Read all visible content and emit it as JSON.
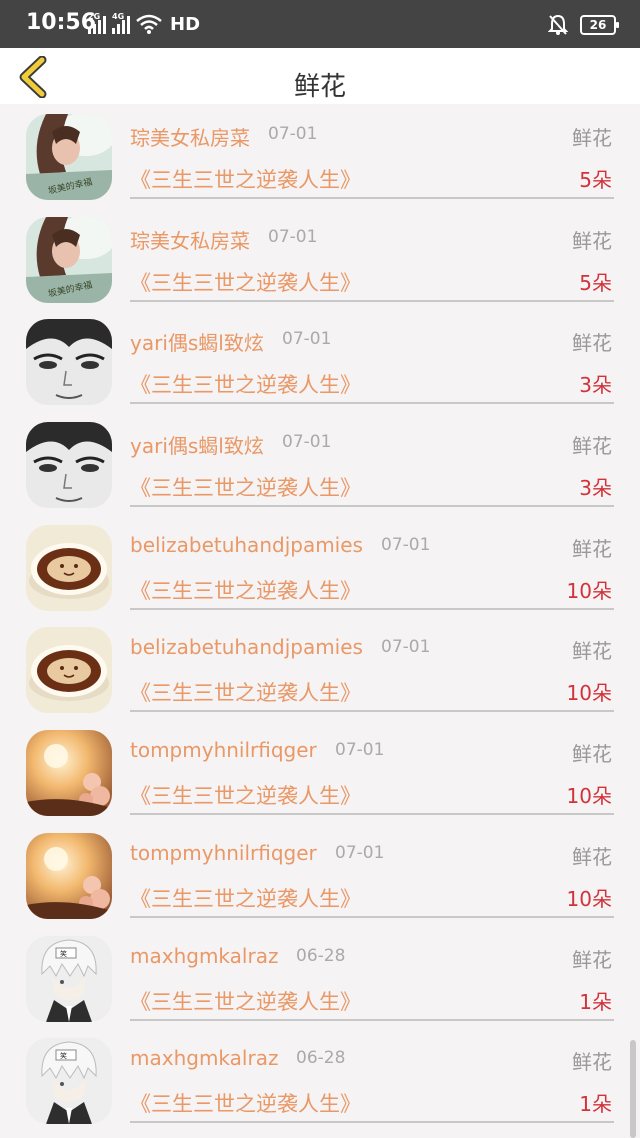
{
  "status_bar": {
    "time": "10:56",
    "sig1_label": "2G",
    "sig2_label": "4G",
    "hd_label": "HD",
    "battery": "26"
  },
  "header": {
    "title": "鲜花"
  },
  "items": [
    {
      "name": "琮美女私房菜",
      "date": "07-01",
      "type": "鲜花",
      "book": "《三生三世之逆袭人生》",
      "amount": "5朵",
      "avatar": "girl-portrait"
    },
    {
      "name": "琮美女私房菜",
      "date": "07-01",
      "type": "鲜花",
      "book": "《三生三世之逆袭人生》",
      "amount": "5朵",
      "avatar": "girl-portrait"
    },
    {
      "name": "yari偶s蝎l致炫",
      "date": "07-01",
      "type": "鲜花",
      "book": "《三生三世之逆袭人生》",
      "amount": "3朵",
      "avatar": "sketch-face"
    },
    {
      "name": "yari偶s蝎l致炫",
      "date": "07-01",
      "type": "鲜花",
      "book": "《三生三世之逆袭人生》",
      "amount": "3朵",
      "avatar": "sketch-face"
    },
    {
      "name": "belizabetuhandjpamies",
      "date": "07-01",
      "type": "鲜花",
      "book": "《三生三世之逆袭人生》",
      "amount": "10朵",
      "avatar": "coffee-cup"
    },
    {
      "name": "belizabetuhandjpamies",
      "date": "07-01",
      "type": "鲜花",
      "book": "《三生三世之逆袭人生》",
      "amount": "10朵",
      "avatar": "coffee-cup"
    },
    {
      "name": "tompmyhnilrfiqger",
      "date": "07-01",
      "type": "鲜花",
      "book": "《三生三世之逆袭人生》",
      "amount": "10朵",
      "avatar": "sunset-rose"
    },
    {
      "name": "tompmyhnilrfiqger",
      "date": "07-01",
      "type": "鲜花",
      "book": "《三生三世之逆袭人生》",
      "amount": "10朵",
      "avatar": "sunset-rose"
    },
    {
      "name": "maxhgmkalraz",
      "date": "06-28",
      "type": "鲜花",
      "book": "《三生三世之逆袭人生》",
      "amount": "1朵",
      "avatar": "anime-boy"
    },
    {
      "name": "maxhgmkalraz",
      "date": "06-28",
      "type": "鲜花",
      "book": "《三生三世之逆袭人生》",
      "amount": "1朵",
      "avatar": "anime-boy"
    }
  ],
  "colors": {
    "accent": "#e99866",
    "amount": "#d2323a",
    "back_arrow": "#f0cc3a"
  }
}
